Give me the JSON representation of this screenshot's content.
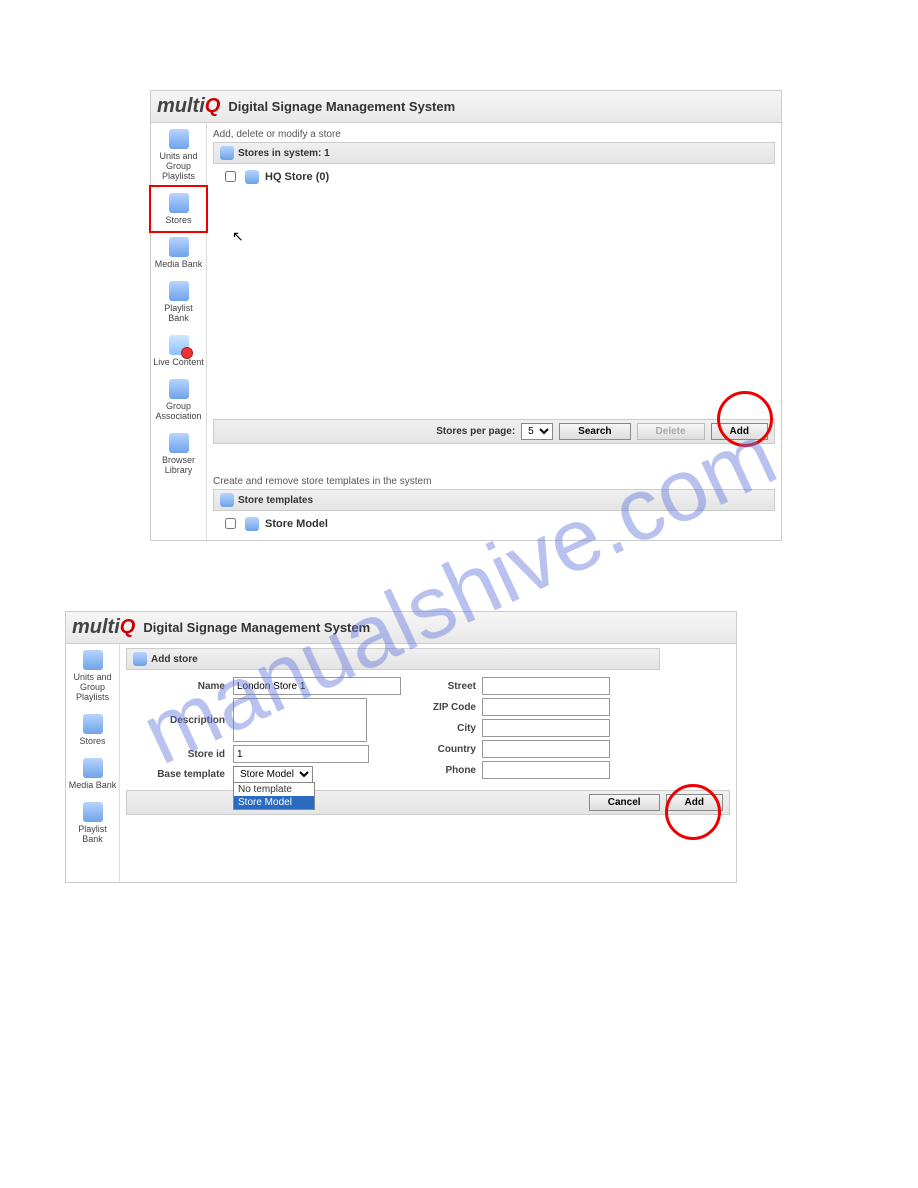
{
  "watermark": "manualshive.com",
  "header": {
    "brand_prefix": "multi",
    "brand_suffix": "Q",
    "title": "Digital Signage Management System"
  },
  "sidebar": {
    "items": [
      {
        "label": "Units and Group Playlists"
      },
      {
        "label": "Stores"
      },
      {
        "label": "Media Bank"
      },
      {
        "label": "Playlist Bank"
      },
      {
        "label": "Live Content"
      },
      {
        "label": "Group Association"
      },
      {
        "label": "Browser Library"
      }
    ]
  },
  "screen1": {
    "note": "Add, delete or modify a store",
    "stores_header": "Stores in system: 1",
    "store_item": "HQ Store (0)",
    "bar": {
      "per_page_label": "Stores per page:",
      "per_page_value": "5",
      "search": "Search",
      "delete": "Delete",
      "add": "Add"
    },
    "templates_note": "Create and remove store templates in the system",
    "templates_header": "Store templates",
    "template_item": "Store Model"
  },
  "screen2": {
    "panel_title": "Add store",
    "labels": {
      "name": "Name",
      "description": "Description",
      "store_id": "Store id",
      "base_template": "Base template",
      "street": "Street",
      "zip": "ZIP Code",
      "city": "City",
      "country": "Country",
      "phone": "Phone"
    },
    "values": {
      "name": "London Store 1",
      "store_id": "1",
      "base_template": "Store Model"
    },
    "dropdown": {
      "opt1": "No template",
      "opt2": "Store Model"
    },
    "buttons": {
      "cancel": "Cancel",
      "add": "Add"
    }
  }
}
